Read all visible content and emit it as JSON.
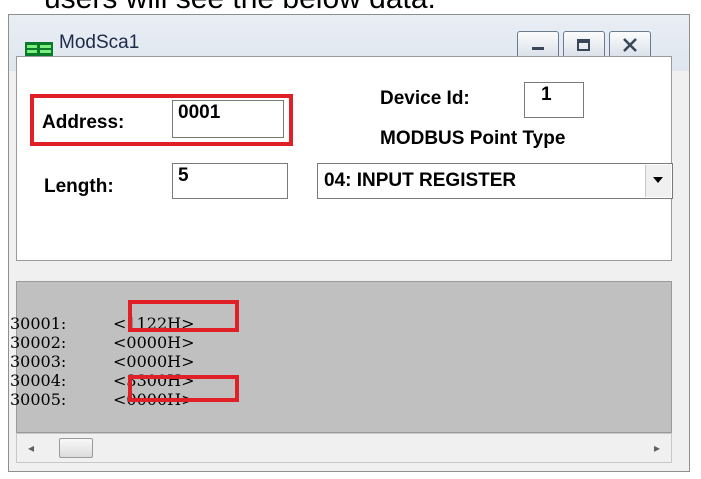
{
  "caption": "users will see the below data.",
  "window": {
    "title": "ModSca1",
    "controls": {
      "minimize_icon": "minimize-icon",
      "maximize_icon": "maximize-icon",
      "close_icon": "close-icon"
    }
  },
  "form": {
    "address_label": "Address:",
    "address_value": "0001",
    "length_label": "Length:",
    "length_value": "5",
    "device_id_label": "Device Id:",
    "device_id_value": "1",
    "point_type_label": "MODBUS Point Type",
    "point_type_value": "04: INPUT REGISTER"
  },
  "data_rows": [
    {
      "address": "30001:",
      "value": "<1122H>",
      "highlighted": true
    },
    {
      "address": "30002:",
      "value": "<0000H>",
      "highlighted": false
    },
    {
      "address": "30003:",
      "value": "<0000H>",
      "highlighted": false
    },
    {
      "address": "30004:",
      "value": "<3300H>",
      "highlighted": true
    },
    {
      "address": "30005:",
      "value": "<0000H>",
      "highlighted": false
    }
  ],
  "scrollbar": {
    "left_arrow": "◂",
    "right_arrow": "▸"
  },
  "colors": {
    "highlight": "#e01f27",
    "data_pane_bg": "#c0c0c0"
  }
}
